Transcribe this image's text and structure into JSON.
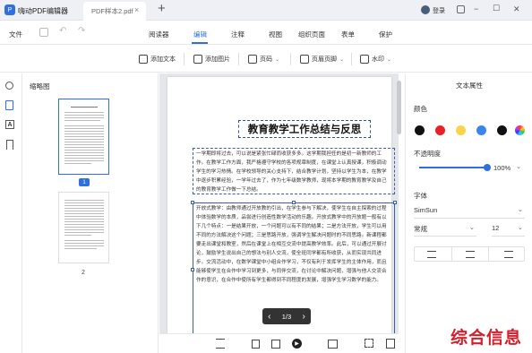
{
  "app": {
    "name": "嗨动PDF编辑器",
    "tab_title": "PDF样本2.pdf",
    "close": "×",
    "new_tab": "+",
    "login": "登录"
  },
  "window": {
    "minimize": "−",
    "maximize": "☐",
    "close": "✕"
  },
  "menu": {
    "file": "文件",
    "items": [
      "阅读器",
      "编辑",
      "注释",
      "视图",
      "组织页面",
      "表单",
      "保护"
    ],
    "active": "编辑"
  },
  "toolbar": {
    "add_text": "添加文本",
    "add_image": "添加图片",
    "page_num": "页码",
    "header_footer": "页眉页脚",
    "watermark": "水印"
  },
  "thumbnails": {
    "title": "缩略图",
    "page1_label": "1",
    "page2_label": "2"
  },
  "document": {
    "title": "教育教学工作总结与反思",
    "para1": "一学期即将过去，可以说是紧张忙碌而收获多多。这学期我担任的是初一新教师的工作。在教学工作方面，我严格遵守学校的各项规章制度，在课堂上认真授课，积极调动学生的学习热情。在学校领导的关心支持下，结合教学计划，坚持以学生为本，在教学中逐步积累经验，一学年过去了，作为七年级数学教师，现将本学期的教育教学及自己的教育教学工作做一下总结。",
    "para2": "开放式教学：由教师通过开放教的引出，在学生参与下解决，使学生在自主探索的过程中体验数学的本质，品尝进行创造性数学活动的乐趣。开放式教学中的开放题一般有以下几个特点：一是结果开放，一个问题可以有不同的结果；二是方法开放，学生可以用不同的方法解决这个问题；三是思路开放，强调学生解决问题时的不同思路。新课程都要走出课堂和教室，然后在课堂上在相互交流中提高教学效率。此后，可以通过开展讨论，鼓励学生说出自己的想法与别人交流，使全班同学都有所收获，从而实现共同进步。交流活动中，在数学课堂中小组合作学习，不仅有利于发挥学生的主体作用，而且能够使学生在合作中学习到更多，与同伴交流，在讨论中解决问题，增强与他人交流合作的意识，在合作中使所有学生都得到不同程度的发展，增强学生学习数学的能力。"
  },
  "pager": {
    "prev": "‹",
    "text": "1/3",
    "next": "›"
  },
  "props": {
    "title": "文本属性",
    "color_label": "颜色",
    "colors": [
      "#111111",
      "#e8202a",
      "#f7d44a",
      "#3a86e8",
      "#111111"
    ],
    "opacity_label": "不透明度",
    "opacity_value": "100%",
    "opacity": 1.0,
    "font_label": "字体",
    "font_value": "SimSun",
    "style_value": "常规",
    "size_value": "12"
  },
  "watermark_text": "综合信息"
}
